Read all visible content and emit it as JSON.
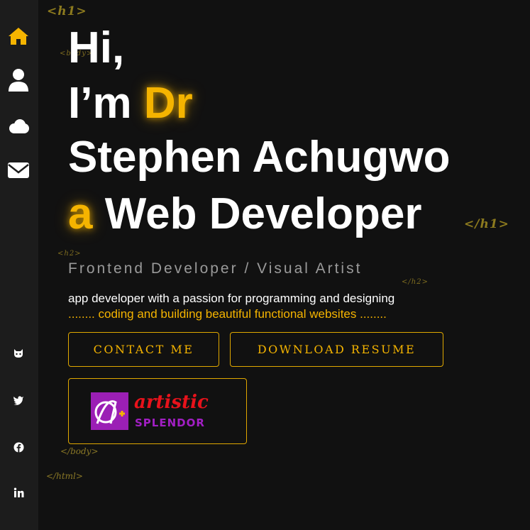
{
  "sidebar": {
    "nav": [
      {
        "icon": "home-icon",
        "color": "#f5b400"
      },
      {
        "icon": "user-icon",
        "color": "#ffffff"
      },
      {
        "icon": "cloud-icon",
        "color": "#ffffff"
      },
      {
        "icon": "envelope-icon",
        "color": "#ffffff"
      }
    ],
    "social": [
      {
        "icon": "github-icon"
      },
      {
        "icon": "twitter-icon"
      },
      {
        "icon": "facebook-icon"
      },
      {
        "icon": "linkedin-icon"
      }
    ]
  },
  "tags": {
    "h1_open": "<h1>",
    "body_open": "<body>",
    "h1_close": "</h1>",
    "h2_open": "<h2>",
    "h2_close": "</h2>",
    "body_close": "</body>",
    "html_close": "</html>"
  },
  "hero": {
    "line1": "Hi,",
    "line2_prefix": "I’m",
    "line2_accent": "Dr",
    "line3": "Stephen Achugwo",
    "line4_accent": "a",
    "line4": "Web Developer"
  },
  "subtitle": "Frontend Developer / Visual Artist",
  "description": {
    "line1": "app developer with a passion for programming and designing",
    "line2": "........ coding and building beautiful functional websites ........"
  },
  "buttons": {
    "contact": "CONTACT ME",
    "resume": "DOWNLOAD RESUME"
  },
  "logo": {
    "word1": "artistic",
    "word2": "SPLENDOR"
  },
  "colors": {
    "accent": "#f5b400",
    "background": "#111111",
    "sidebar": "#1c1c1c"
  }
}
